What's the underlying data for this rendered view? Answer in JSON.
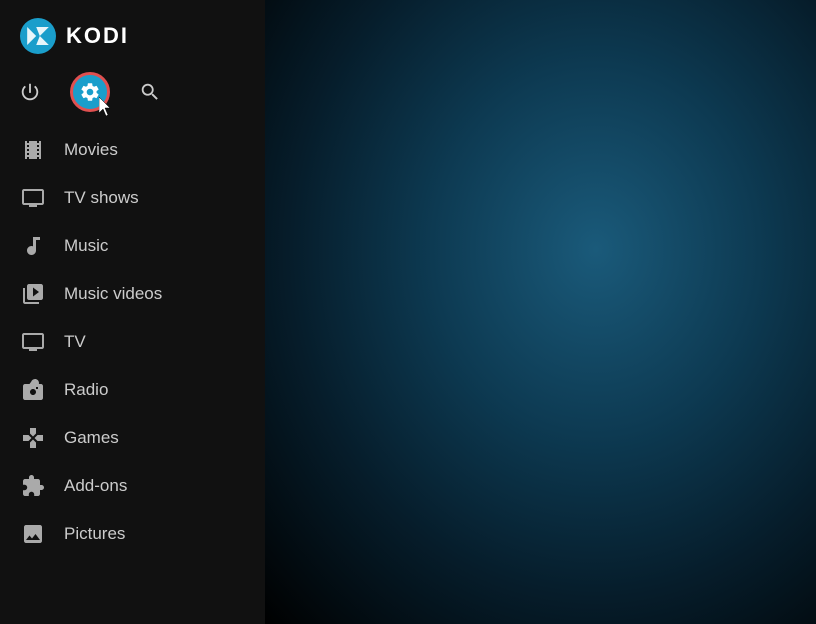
{
  "app": {
    "title": "KODI"
  },
  "topIcons": [
    {
      "name": "power",
      "label": "Power",
      "active": false
    },
    {
      "name": "settings",
      "label": "Settings",
      "active": true
    },
    {
      "name": "search",
      "label": "Search",
      "active": false
    }
  ],
  "nav": {
    "items": [
      {
        "id": "movies",
        "label": "Movies",
        "icon": "movies"
      },
      {
        "id": "tvshows",
        "label": "TV shows",
        "icon": "tvshows"
      },
      {
        "id": "music",
        "label": "Music",
        "icon": "music"
      },
      {
        "id": "musicvideos",
        "label": "Music videos",
        "icon": "musicvideos"
      },
      {
        "id": "tv",
        "label": "TV",
        "icon": "tv"
      },
      {
        "id": "radio",
        "label": "Radio",
        "icon": "radio"
      },
      {
        "id": "games",
        "label": "Games",
        "icon": "games"
      },
      {
        "id": "addons",
        "label": "Add-ons",
        "icon": "addons"
      },
      {
        "id": "pictures",
        "label": "Pictures",
        "icon": "pictures"
      }
    ]
  },
  "colors": {
    "settingsActive": "#1a9ecb",
    "settingsBorder": "#e05050",
    "sidebarBg": "#111111",
    "mainBg": "#061d2b"
  }
}
